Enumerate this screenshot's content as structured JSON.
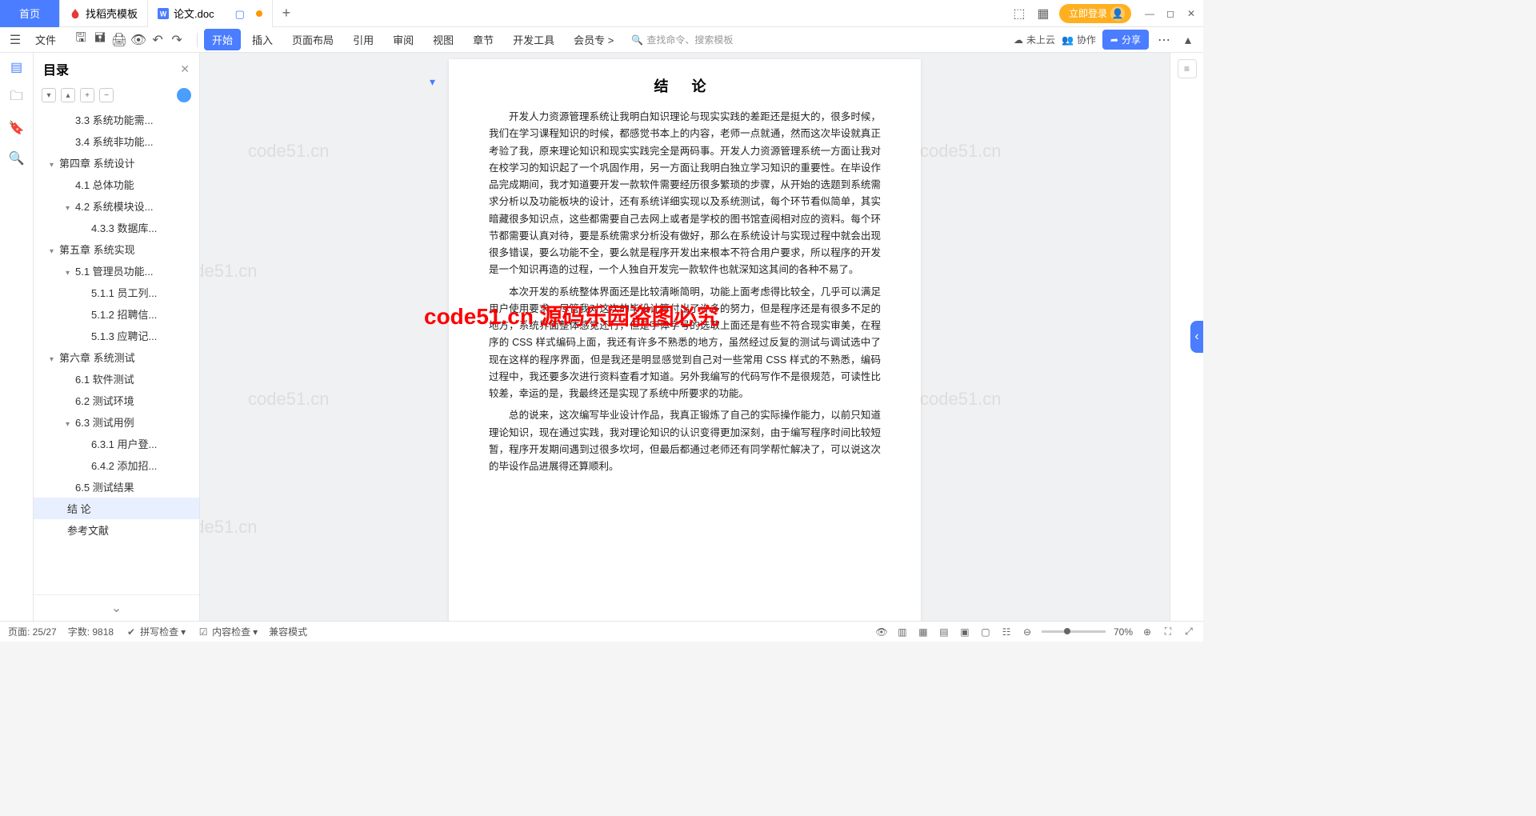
{
  "tabs": {
    "home": "首页",
    "template": "找稻壳模板",
    "doc": "论文.doc"
  },
  "titlebar": {
    "login": "立即登录"
  },
  "toolbar": {
    "file": "文件",
    "menus": [
      "开始",
      "插入",
      "页面布局",
      "引用",
      "审阅",
      "视图",
      "章节",
      "开发工具",
      "会员专"
    ],
    "search_placeholder": "查找命令、搜索模板",
    "cloud": "未上云",
    "collab": "协作",
    "share": "分享"
  },
  "outline": {
    "title": "目录",
    "items": [
      {
        "pad": 40,
        "chev": "",
        "label": "3.3 系统功能需..."
      },
      {
        "pad": 40,
        "chev": "",
        "label": "3.4 系统非功能..."
      },
      {
        "pad": 20,
        "chev": "▾",
        "label": "第四章  系统设计"
      },
      {
        "pad": 40,
        "chev": "",
        "label": "4.1 总体功能"
      },
      {
        "pad": 40,
        "chev": "▾",
        "label": "4.2  系统模块设..."
      },
      {
        "pad": 60,
        "chev": "",
        "label": "4.3.3 数据库..."
      },
      {
        "pad": 20,
        "chev": "▾",
        "label": "第五章  系统实现"
      },
      {
        "pad": 40,
        "chev": "▾",
        "label": "5.1  管理员功能..."
      },
      {
        "pad": 60,
        "chev": "",
        "label": "5.1.1 员工列..."
      },
      {
        "pad": 60,
        "chev": "",
        "label": "5.1.2 招聘信..."
      },
      {
        "pad": 60,
        "chev": "",
        "label": "5.1.3 应聘记..."
      },
      {
        "pad": 20,
        "chev": "▾",
        "label": "第六章  系统测试"
      },
      {
        "pad": 40,
        "chev": "",
        "label": "6.1 软件测试"
      },
      {
        "pad": 40,
        "chev": "",
        "label": "6.2 测试环境"
      },
      {
        "pad": 40,
        "chev": "▾",
        "label": "6.3  测试用例"
      },
      {
        "pad": 60,
        "chev": "",
        "label": "6.3.1 用户登..."
      },
      {
        "pad": 60,
        "chev": "",
        "label": "6.4.2 添加招..."
      },
      {
        "pad": 40,
        "chev": "",
        "label": "6.5 测试结果"
      },
      {
        "pad": 30,
        "chev": "",
        "label": "结   论",
        "selected": true
      },
      {
        "pad": 30,
        "chev": "",
        "label": "参考文献"
      }
    ]
  },
  "document": {
    "title": "结  论",
    "p1": "开发人力资源管理系统让我明白知识理论与现实实践的差距还是挺大的，很多时候，我们在学习课程知识的时候，都感觉书本上的内容，老师一点就通，然而这次毕设就真正考验了我，原来理论知识和现实实践完全是两码事。开发人力资源管理系统一方面让我对在校学习的知识起了一个巩固作用，另一方面让我明白独立学习知识的重要性。在毕设作品完成期间，我才知道要开发一款软件需要经历很多繁琐的步骤，从开始的选题到系统需求分析以及功能板块的设计，还有系统详细实现以及系统测试，每个环节看似简单，其实暗藏很多知识点，这些都需要自己去网上或者是学校的图书馆查阅相对应的资料。每个环节都需要认真对待，要是系统需求分析没有做好，那么在系统设计与实现过程中就会出现很多错误，要么功能不全，要么就是程序开发出来根本不符合用户要求，所以程序的开发是一个知识再造的过程，一个人独自开发完一款软件也就深知这其间的各种不易了。",
    "p2": "本次开发的系统整体界面还是比较清晰简明，功能上面考虑得比较全，几乎可以满足用户使用要求。尽管我对这次的毕设计算付出了许多的努力，但是程序还是有很多不足的地方，系统界面整体感觉还行，但是字体字号的选取上面还是有些不符合现实审美，在程序的 CSS 样式编码上面，我还有许多不熟悉的地方，虽然经过反复的测试与调试选中了现在这样的程序界面，但是我还是明显感觉到自己对一些常用 CSS 样式的不熟悉，编码过程中，我还要多次进行资料查看才知道。另外我编写的代码写作不是很规范，可读性比较差，幸运的是，我最终还是实现了系统中所要求的功能。",
    "p3": "总的说来，这次编写毕业设计作品，我真正锻炼了自己的实际操作能力，以前只知道理论知识，现在通过实践，我对理论知识的认识变得更加深刻，由于编写程序时间比较短暂，程序开发期间遇到过很多坎坷，但最后都通过老师还有同学帮忙解决了，可以说这次的毕设作品进展得还算顺利。"
  },
  "watermarks": {
    "main": "code51.cn 源码乐园盗图必究",
    "bg": "code51.cn"
  },
  "statusbar": {
    "page": "页面: 25/27",
    "words": "字数: 9818",
    "spell": "拼写检查",
    "content": "内容检查",
    "compat": "兼容模式",
    "zoom": "70%"
  }
}
